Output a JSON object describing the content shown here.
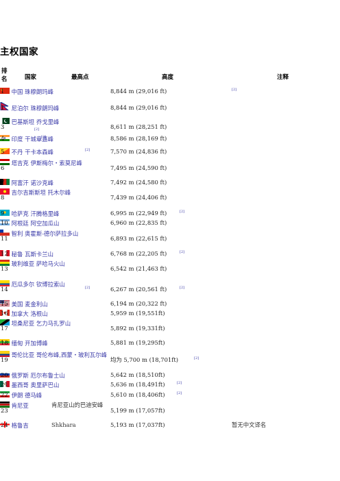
{
  "page": {
    "title": "主权国家"
  },
  "table": {
    "headers": {
      "rank": "排名",
      "country": "国家",
      "peak": "最高点",
      "height": "高度",
      "note": "注释"
    },
    "rows": [
      {
        "rank": "1",
        "country": "中国",
        "peak": "珠穆朗玛峰",
        "height": "8,844  m (29,016 ft)",
        "note": "",
        "flag": "china"
      },
      {
        "rank": "1",
        "country": "尼泊尔",
        "peak": "珠穆朗玛峰",
        "height": "8,844  m (29,016 ft)",
        "note": "",
        "flag": "nepal"
      },
      {
        "rank": "3",
        "country": "巴基斯坦",
        "peak": "乔戈里峰",
        "height": "8,611  m (28,251 ft)",
        "note": "",
        "flag": "pakistan"
      },
      {
        "rank": "4",
        "country": "印度",
        "peak": "干城章嘉峰",
        "height": "8,586  m (28,169 ft)",
        "note": "",
        "flag": "india"
      },
      {
        "rank": "5",
        "country": "不丹",
        "peak": "干卡本森峰",
        "height": "7,570  m (24,836 ft)",
        "note": "",
        "flag": "bhutan"
      },
      {
        "rank": "6",
        "country": "塔吉克",
        "peak": "伊斯梅尔・索莫尼峰",
        "height": "7,495  m (24,590 ft)",
        "note": "",
        "flag": "tajikistan"
      },
      {
        "rank": "7",
        "country": "阿富汗",
        "peak": "诺沙克峰",
        "height": "7,492  m (24,580 ft)",
        "note": "",
        "flag": "afghanistan"
      },
      {
        "rank": "8",
        "country": "吉尔吉斯斯坦",
        "peak": "托木尔峰",
        "height": "7,439  m (24,406 ft)",
        "note": "",
        "flag": "kyrgyzstan"
      },
      {
        "rank": "9",
        "country": "哈萨克",
        "peak": "汗腾格里峰",
        "height": "6,995  m (22,949 ft)",
        "note": "",
        "flag": "kazakhstan"
      },
      {
        "rank": "10",
        "country": "阿根廷",
        "peak": "阿空加瓜山",
        "height": "6,960  m (22,835 ft)",
        "note": "",
        "flag": "argentina"
      },
      {
        "rank": "11",
        "country": "智利",
        "peak": "奥霍斯-德尔萨拉多山",
        "height": "6,893  m (22,615 ft)",
        "note": "",
        "flag": "chile"
      },
      {
        "rank": "12",
        "country": "秘鲁",
        "peak": "瓦斯卡兰山",
        "height": "6,768  m (22,205 ft)",
        "note": "",
        "flag": "peru"
      },
      {
        "rank": "13",
        "country": "玻利维亚",
        "peak": "萨哈马火山",
        "height": "6,542  m (21,463 ft)",
        "note": "",
        "flag": "bolivia"
      },
      {
        "rank": "14",
        "country": "厄瓜多尔",
        "peak": "钦博拉索山",
        "height": "6,267  m (20,561 ft)",
        "note": "",
        "flag": "ecuador"
      },
      {
        "rank": "15",
        "country": "美国",
        "peak": "麦金利山",
        "height": "6,194  m (20,322 ft)",
        "note": "",
        "flag": "usa"
      },
      {
        "rank": "16",
        "country": "加拿大",
        "peak": "洛根山",
        "height": "5,959  m (19,551ft)",
        "note": "",
        "flag": "canada"
      },
      {
        "rank": "17",
        "country": "坦桑尼亚",
        "peak": "乞力马扎罗山",
        "height": "5,892  m (19,331ft)",
        "note": "",
        "flag": "tanzania"
      },
      {
        "rank": "18",
        "country": "缅甸",
        "peak": "开加博峰",
        "height": "5,881  m (19,295ft)",
        "note": "",
        "flag": "myanmar"
      },
      {
        "rank": "19",
        "country": "哥伦比亚",
        "peak": "哥伦布峰,西蒙・玻利瓦尔峰",
        "height": "均为 5,700  m (18,701ft)",
        "note": "",
        "flag": "colombia"
      },
      {
        "rank": "20",
        "country": "俄罗斯",
        "peak": "厄尔布鲁士山",
        "height": "5,642  m (18,510ft)",
        "note": "",
        "flag": "russia"
      },
      {
        "rank": "21",
        "country": "墨西哥",
        "peak": "奥里萨巴山",
        "height": "5,636  m (18,491ft)",
        "note": "",
        "flag": "mexico"
      },
      {
        "rank": "22",
        "country": "伊朗",
        "peak": "德马峰",
        "height": "5,610  m (18,406ft)",
        "note": "",
        "flag": "iran"
      },
      {
        "rank": "23",
        "country": "肯尼亚",
        "peak": "肯尼亚山的巴迪安峰",
        "height": "5,199  m (17,057ft)",
        "note": "",
        "flag": "kenya"
      },
      {
        "rank": "24",
        "country": "格鲁吉",
        "peak": "Shkhara",
        "height": "5,193  m (17,037ft)",
        "note": "暂无中文译名",
        "flag": "georgia"
      }
    ],
    "ref_mark": "[2]"
  }
}
